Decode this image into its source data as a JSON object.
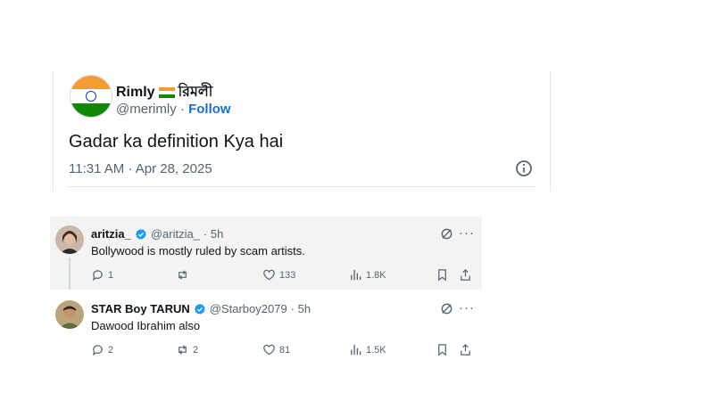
{
  "embed": {
    "name": "Rimly",
    "name_bengali": "রিমলী",
    "handle": "@merimly",
    "separator": "·",
    "follow": "Follow",
    "text": "Gadar ka definition Kya hai",
    "timestamp": "11:31 AM · Apr 28, 2025",
    "flag_colors": {
      "saffron": "#f49b33",
      "white": "#ffffff",
      "green": "#138808",
      "chakra": "#1d3e93"
    }
  },
  "replies": [
    {
      "name": "aritzia_",
      "handle": "@aritzia_",
      "time": "· 5h",
      "text": "Bollywood is mostly ruled by scam artists.",
      "reply_count": "1",
      "repost_count": "",
      "like_count": "133",
      "view_count": "1.8K",
      "more": "···"
    },
    {
      "name": "STAR Boy TARUN",
      "handle": "@Starboy2079",
      "time": "· 5h",
      "text": "Dawood Ibrahim also",
      "reply_count": "2",
      "repost_count": "2",
      "like_count": "81",
      "view_count": "1.5K",
      "more": "···"
    }
  ],
  "colors": {
    "accent": "#1d9bf0",
    "follow": "#1d70c7",
    "muted": "#536471",
    "text": "#0f1419"
  },
  "icons": [
    "info-icon",
    "verified-icon",
    "grok-icon",
    "more-icon",
    "reply-icon",
    "repost-icon",
    "like-icon",
    "views-icon",
    "bookmark-icon",
    "share-icon"
  ]
}
